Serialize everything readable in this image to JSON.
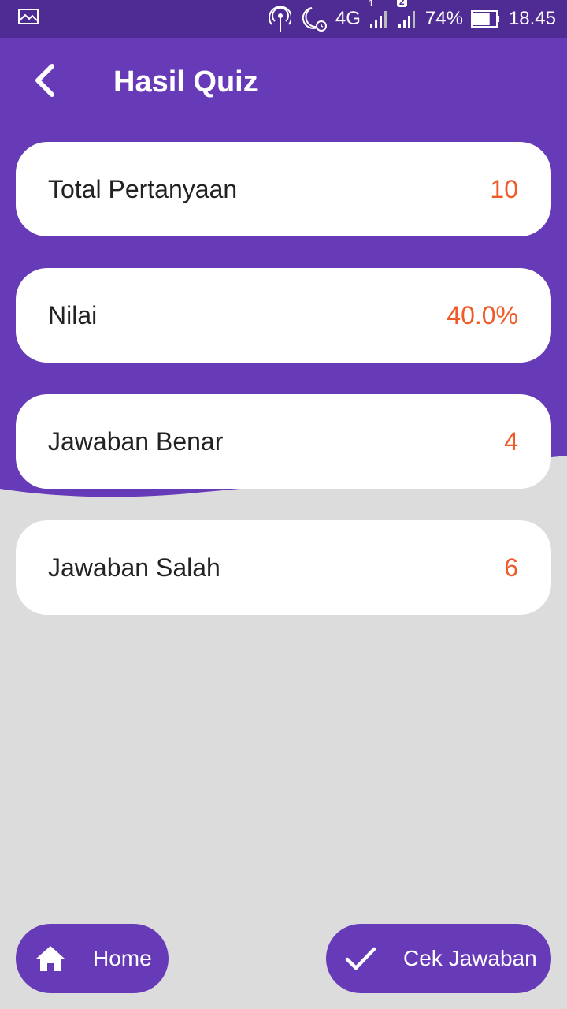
{
  "status_bar": {
    "network": "4G",
    "sim1": "1",
    "sim2": "2",
    "battery": "74%",
    "battery_level": 0.74,
    "time": "18.45",
    "icons": [
      "image-icon",
      "hotspot-icon",
      "moon-alarm-icon",
      "signal-icon",
      "battery-icon"
    ]
  },
  "appbar": {
    "title": "Hasil Quiz",
    "back_icon": "chevron-left-icon"
  },
  "results": [
    {
      "label": "Total Pertanyaan",
      "value": "10"
    },
    {
      "label": "Nilai",
      "value": "40.0%"
    },
    {
      "label": "Jawaban Benar",
      "value": "4"
    },
    {
      "label": "Jawaban Salah",
      "value": "6"
    }
  ],
  "buttons": {
    "home_label": "Home",
    "home_icon": "home-icon",
    "check_label": "Cek Jawaban",
    "check_icon": "check-icon"
  },
  "colors": {
    "primary": "#673ab7",
    "status_bar": "#4f2b94",
    "value": "#f05a28",
    "background": "#dcdcdc",
    "card": "#ffffff"
  }
}
